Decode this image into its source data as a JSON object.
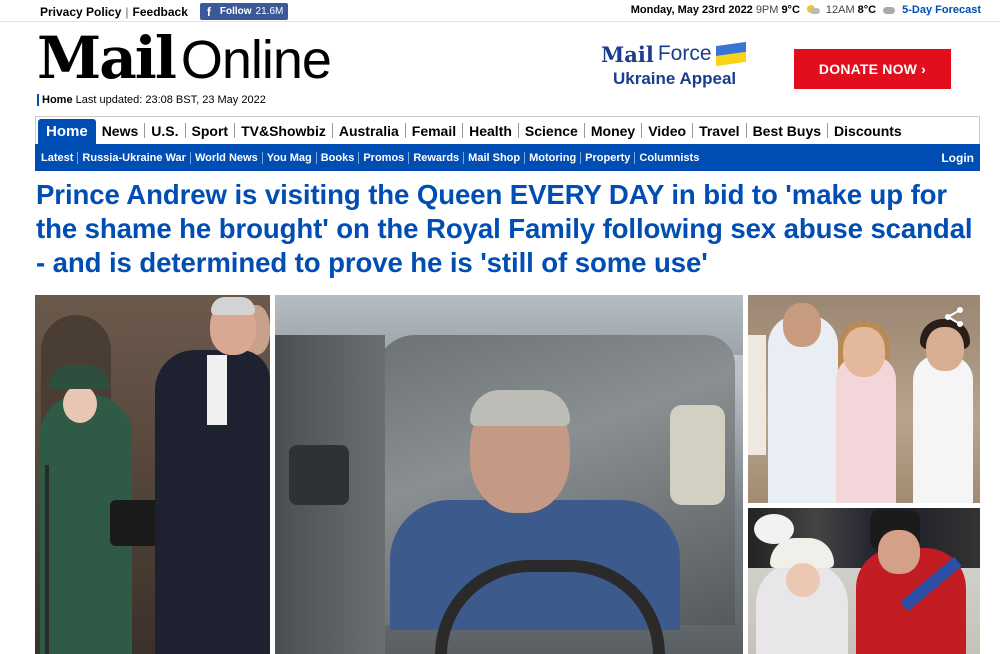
{
  "topbar": {
    "privacy": "Privacy Policy",
    "sep": "|",
    "feedback": "Feedback",
    "fb_icon": "f",
    "fb_follow": "Follow",
    "fb_count": "21.6M",
    "date": "Monday, May 23rd 2022",
    "time1": "9PM",
    "temp1": "9°C",
    "time2": "12AM",
    "temp2": "8°C",
    "forecast": "5-Day Forecast"
  },
  "masthead": {
    "logo_mail": "Mail",
    "logo_online": "Online",
    "home": "Home",
    "updated": "Last updated: 23:08 BST, 23 May 2022"
  },
  "promo": {
    "mail": "Mail",
    "force": "Force",
    "appeal": "Ukraine Appeal",
    "donate": "DONATE NOW ›"
  },
  "nav_primary": [
    "Home",
    "News",
    "U.S.",
    "Sport",
    "TV&Showbiz",
    "Australia",
    "Femail",
    "Health",
    "Science",
    "Money",
    "Video",
    "Travel",
    "Best Buys",
    "Discounts"
  ],
  "nav_secondary": [
    "Latest",
    "Russia-Ukraine War",
    "World News",
    "You Mag",
    "Books",
    "Promos",
    "Rewards",
    "Mail Shop",
    "Motoring",
    "Property",
    "Columnists"
  ],
  "nav_login": "Login",
  "article": {
    "headline": "Prince Andrew is visiting the Queen EVERY DAY in bid to 'make up for the shame he brought' on the Royal Family following sex abuse scandal - and is determined to prove he is 'still of some use'"
  },
  "colors": {
    "brand_blue": "#004db3",
    "donate_red": "#e20e1d",
    "facebook": "#3b5998"
  },
  "icons": {
    "facebook": "facebook-icon",
    "weather_1": "sun-cloud-icon",
    "weather_2": "cloud-icon",
    "share": "share-icon",
    "ukraine_flag": "ukraine-flag-icon"
  }
}
